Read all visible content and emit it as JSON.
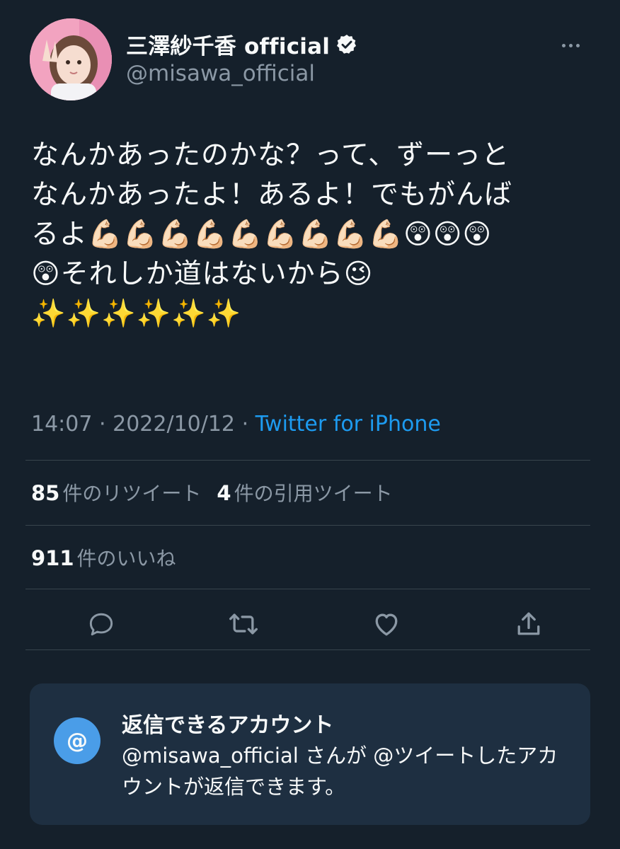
{
  "user": {
    "display_name": "三澤紗千香 official",
    "handle": "@misawa_official",
    "verified_icon": "verified-badge-icon"
  },
  "tweet": {
    "text": "なんかあったのかな？って、ずーっと\nなんかあったよ！あるよ！でもがんば\nるよ💪🏻💪🏻💪🏻💪🏻💪🏻💪🏻💪🏻💪🏻💪🏻😲😲😲\n😲それしか道はないから😉\n✨✨✨✨✨✨",
    "time": "14:07",
    "date": "2022/10/12",
    "separator": "·",
    "source": "Twitter for iPhone"
  },
  "stats": {
    "retweets_count": "85",
    "retweets_label": "件のリツイート",
    "quotes_count": "4",
    "quotes_label": "件の引用ツイート",
    "likes_count": "911",
    "likes_label": "件のいいね"
  },
  "reply_card": {
    "title": "返信できるアカウント",
    "body": "@misawa_official さんが @ツイートしたアカウントが返信できます。",
    "icon_text": "@"
  },
  "colors": {
    "background": "#15202b",
    "accent": "#1d9bf0",
    "card": "#1e2f41",
    "muted": "#8b98a5"
  }
}
